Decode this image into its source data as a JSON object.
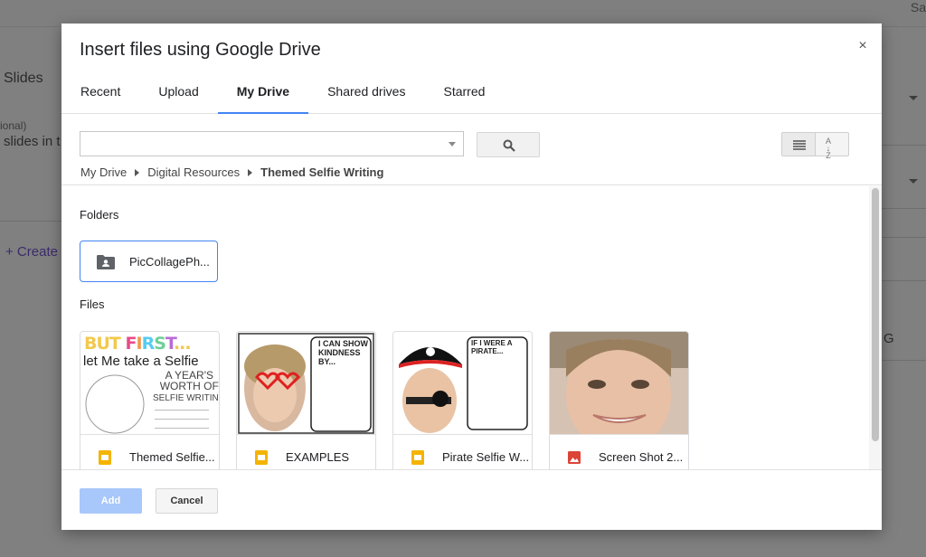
{
  "background": {
    "top_right_text": "Sa",
    "left_panel": {
      "title": "Slides",
      "optional_text": "ional)",
      "slides_in_text": "slides in t",
      "create_text": "+ Create"
    },
    "right_panel": {
      "g_text": "G"
    }
  },
  "dialog": {
    "title": "Insert files using Google Drive",
    "close_label": "×",
    "tabs": [
      {
        "label": "Recent",
        "active": false
      },
      {
        "label": "Upload",
        "active": false
      },
      {
        "label": "My Drive",
        "active": true
      },
      {
        "label": "Shared drives",
        "active": false
      },
      {
        "label": "Starred",
        "active": false
      }
    ],
    "search": {
      "value": "",
      "placeholder": ""
    },
    "breadcrumb": [
      "My Drive",
      "Digital Resources",
      "Themed Selfie Writing"
    ],
    "sections": {
      "folders_title": "Folders",
      "files_title": "Files"
    },
    "folders": [
      {
        "name": "PicCollagePh...",
        "icon": "shared-folder-icon"
      }
    ],
    "files": [
      {
        "name": "Themed Selfie...",
        "icon": "google-slides-icon",
        "thumb": "selfie-writing-cover"
      },
      {
        "name": "EXAMPLES",
        "icon": "google-slides-icon",
        "thumb": "kindness-worksheet"
      },
      {
        "name": "Pirate Selfie W...",
        "icon": "google-slides-icon",
        "thumb": "pirate-worksheet"
      },
      {
        "name": "Screen Shot 2...",
        "icon": "image-file-icon",
        "thumb": "photo-selfie"
      }
    ],
    "footer": {
      "add_label": "Add",
      "cancel_label": "Cancel"
    },
    "thumb_text": {
      "t1_line1": "BUT FIRST...",
      "t1_line2": "let Me take a Selfie",
      "t1_line3": "A YEAR'S",
      "t1_line4": "WORTH OF",
      "t1_line5": "SELFIE WRITING",
      "t2_text": "I CAN SHOW KINDNESS BY...",
      "t3_text": "IF I WERE A PIRATE..."
    }
  },
  "colors": {
    "accent": "#4285f4",
    "add_button_disabled": "#a8c7fa",
    "slides_yellow": "#f4b400",
    "image_red": "#db4437"
  }
}
